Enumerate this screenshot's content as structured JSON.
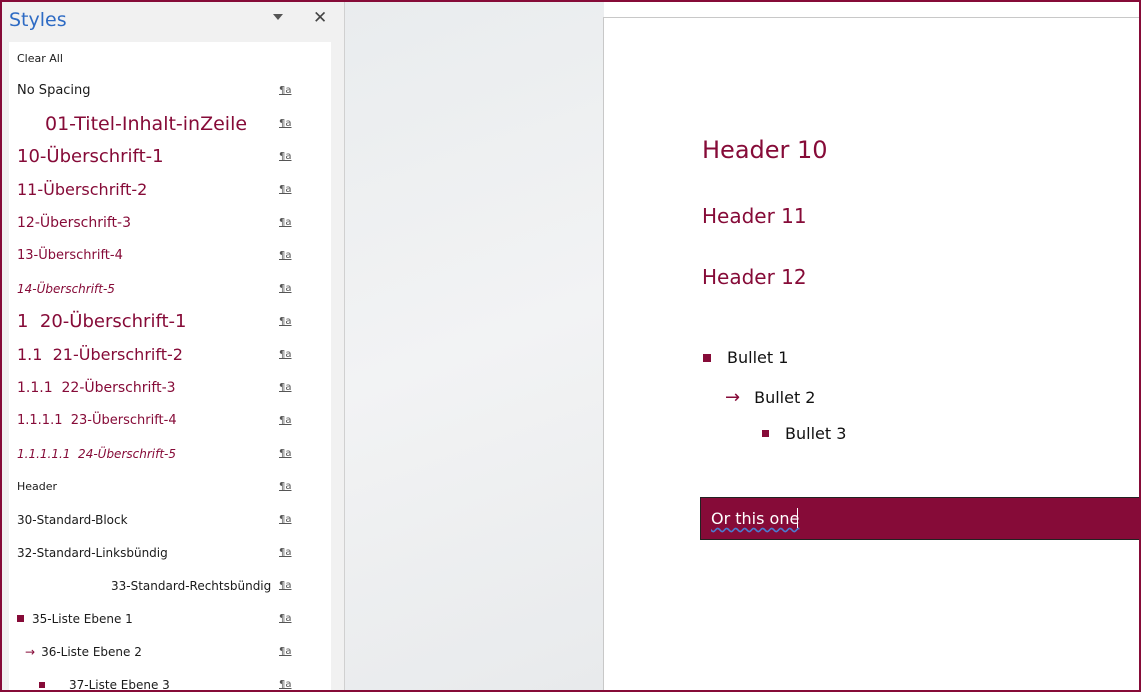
{
  "pane": {
    "title": "Styles",
    "para_symbol": "¶a",
    "items": [
      {
        "label": "Clear All"
      },
      {
        "label": "No Spacing"
      },
      {
        "label": "01-Titel-Inhalt-inZeile"
      },
      {
        "label": "10-Überschrift-1"
      },
      {
        "label": "11-Überschrift-2"
      },
      {
        "label": "12-Überschrift-3"
      },
      {
        "label": "13-Überschrift-4"
      },
      {
        "label": "14-Überschrift-5"
      },
      {
        "label": "1  20-Überschrift-1"
      },
      {
        "label": "1.1  21-Überschrift-2"
      },
      {
        "label": "1.1.1  22-Überschrift-3"
      },
      {
        "label": "1.1.1.1  23-Überschrift-4"
      },
      {
        "label": "1.1.1.1.1  24-Überschrift-5"
      },
      {
        "label": "Header"
      },
      {
        "label": "30-Standard-Block"
      },
      {
        "label": "32-Standard-Linksbündig"
      },
      {
        "label": "33-Standard-Rechtsbündig"
      },
      {
        "label": "35-Liste Ebene 1"
      },
      {
        "label": "36-Liste Ebene 2"
      },
      {
        "label": "37-Liste Ebene 3"
      }
    ]
  },
  "document": {
    "headers": [
      "Header 10",
      "Header 11",
      "Header 12"
    ],
    "bullets": [
      "Bullet 1",
      "Bullet 2",
      "Bullet 3"
    ],
    "highlight_text": "Or this one"
  },
  "colors": {
    "accent": "#860b38",
    "pane_title": "#2e6bc4"
  }
}
